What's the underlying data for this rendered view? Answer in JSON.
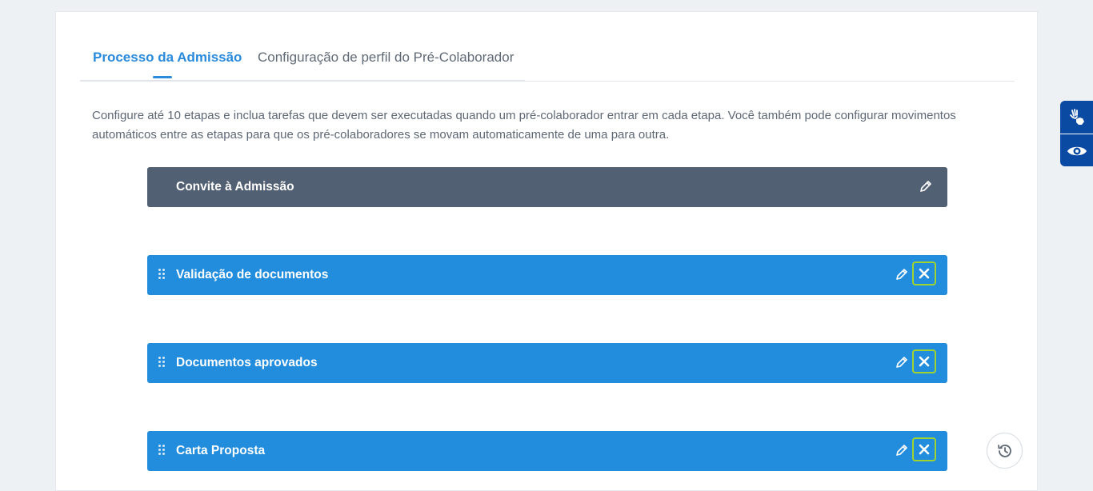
{
  "tabs": [
    {
      "label": "Processo da Admissão",
      "active": true
    },
    {
      "label": "Configuração de perfil do Pré-Colaborador",
      "active": false
    }
  ],
  "description": "Configure até 10 etapas e inclua tarefas que devem ser executadas quando um pré-colaborador entrar em cada etapa. Você também pode configurar movimentos automáticos entre as etapas para que os pré-colaboradores se movam automaticamente de uma para outra.",
  "stages": [
    {
      "title": "Convite à Admissão",
      "type": "fixed",
      "icons": [
        "pencil-icon"
      ]
    },
    {
      "title": "Validação de documentos",
      "type": "movable",
      "icons": [
        "drag-handle-icon",
        "pencil-icon",
        "close-icon"
      ]
    },
    {
      "title": "Documentos aprovados",
      "type": "movable",
      "icons": [
        "drag-handle-icon",
        "pencil-icon",
        "close-icon"
      ]
    },
    {
      "title": "Carta Proposta",
      "type": "movable",
      "icons": [
        "drag-handle-icon",
        "pencil-icon",
        "close-icon"
      ]
    }
  ],
  "side_widget": {
    "icons": [
      "sign-language-hands-icon",
      "eye-icon"
    ]
  },
  "floating_button": {
    "icon": "history-icon"
  },
  "colors": {
    "accent": "#2a8bdc",
    "stage_fixed": "#526073",
    "stage_movable": "#238ddd",
    "delete_border": "#9fd330",
    "side_widget": "#0a4aa3",
    "background": "#eef1f4"
  }
}
